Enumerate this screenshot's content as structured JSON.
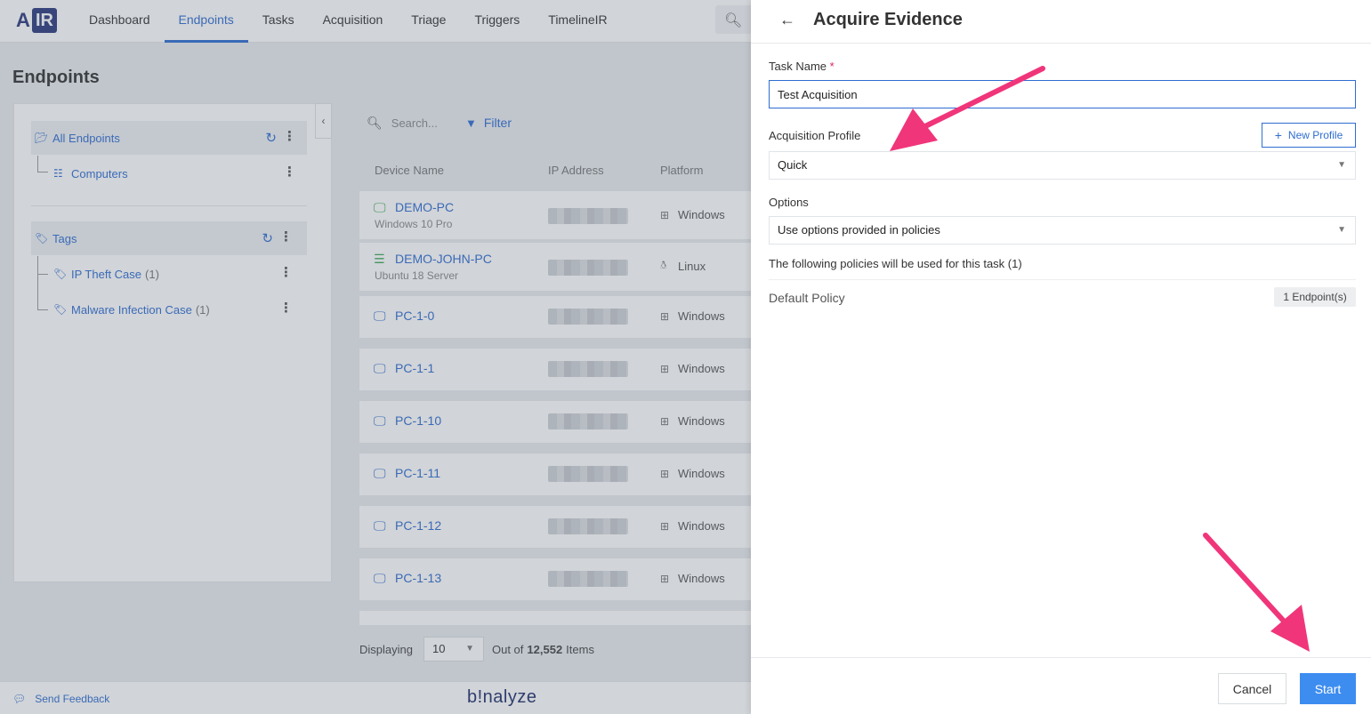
{
  "app": {
    "logo": {
      "a": "A",
      "ir": "IR"
    },
    "nav": [
      "Dashboard",
      "Endpoints",
      "Tasks",
      "Acquisition",
      "Triage",
      "Triggers",
      "TimelineIR"
    ],
    "active_nav": "Endpoints",
    "page_title": "Endpoints"
  },
  "tree": {
    "all_endpoints": "All Endpoints",
    "computers": "Computers",
    "tags": "Tags",
    "tag_items": [
      {
        "label": "IP Theft Case",
        "count": "(1)"
      },
      {
        "label": "Malware Infection Case",
        "count": "(1)"
      }
    ]
  },
  "list": {
    "search_placeholder": "Search...",
    "filter_label": "Filter",
    "columns": [
      "Device Name",
      "IP Address",
      "Platform"
    ],
    "rows": [
      {
        "name": "DEMO-PC",
        "sub": "Windows 10 Pro",
        "platform": "Windows",
        "icon": "monitor-icon",
        "status_color": "#3aa757"
      },
      {
        "name": "DEMO-JOHN-PC",
        "sub": "Ubuntu 18 Server",
        "platform": "Linux",
        "icon": "server-icon",
        "status_color": "#3aa757"
      },
      {
        "name": "PC-1-0",
        "sub": "",
        "platform": "Windows",
        "icon": "monitor-icon",
        "status_color": "#2f6dd1"
      },
      {
        "name": "PC-1-1",
        "sub": "",
        "platform": "Windows",
        "icon": "monitor-icon",
        "status_color": "#2f6dd1"
      },
      {
        "name": "PC-1-10",
        "sub": "",
        "platform": "Windows",
        "icon": "monitor-icon",
        "status_color": "#2f6dd1"
      },
      {
        "name": "PC-1-11",
        "sub": "",
        "platform": "Windows",
        "icon": "monitor-icon",
        "status_color": "#2f6dd1"
      },
      {
        "name": "PC-1-12",
        "sub": "",
        "platform": "Windows",
        "icon": "monitor-icon",
        "status_color": "#2f6dd1"
      },
      {
        "name": "PC-1-13",
        "sub": "",
        "platform": "Windows",
        "icon": "monitor-icon",
        "status_color": "#2f6dd1"
      }
    ],
    "pager": {
      "displaying": "Displaying",
      "page_size": "10",
      "out_of": "Out of",
      "total": "12,552",
      "items": "Items"
    }
  },
  "footer": {
    "feedback": "Send Feedback",
    "brand": "b!nalyze"
  },
  "drawer": {
    "title": "Acquire Evidence",
    "task_name_label": "Task Name",
    "required_mark": "*",
    "task_name_value": "Test Acquisition",
    "profile_label": "Acquisition Profile",
    "new_profile": "New Profile",
    "profile_value": "Quick",
    "options_label": "Options",
    "options_value": "Use options provided in policies",
    "policy_note": "The following policies will be used for this task (1)",
    "policy_name": "Default Policy",
    "policy_badge": "1 Endpoint(s)",
    "cancel": "Cancel",
    "start": "Start"
  },
  "colors": {
    "accent": "#2f6dd1",
    "primary_button": "#3d8cf0",
    "annotation_arrow": "#f0357a",
    "online": "#3aa757"
  }
}
